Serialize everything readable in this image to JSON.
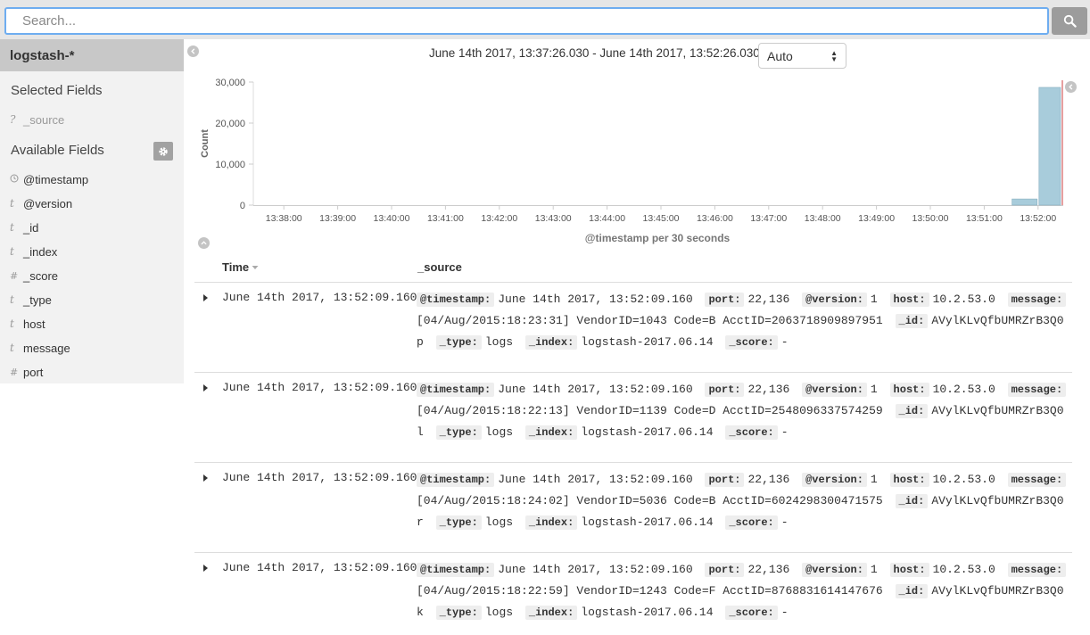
{
  "search": {
    "placeholder": "Search..."
  },
  "sidebar": {
    "index_pattern": "logstash-*",
    "selected_title": "Selected Fields",
    "selected_fields": [
      {
        "type": "?",
        "name": "_source"
      }
    ],
    "available_title": "Available Fields",
    "available_fields": [
      {
        "type": "clock",
        "name": "@timestamp"
      },
      {
        "type": "t",
        "name": "@version"
      },
      {
        "type": "t",
        "name": "_id"
      },
      {
        "type": "t",
        "name": "_index"
      },
      {
        "type": "#",
        "name": "_score"
      },
      {
        "type": "t",
        "name": "_type"
      },
      {
        "type": "t",
        "name": "host"
      },
      {
        "type": "t",
        "name": "message"
      },
      {
        "type": "#",
        "name": "port"
      }
    ]
  },
  "histogram": {
    "range_text": "June 14th 2017, 13:37:26.030 - June 14th 2017, 13:52:26.030 —",
    "interval": "Auto"
  },
  "chart_data": {
    "type": "bar",
    "ylabel": "Count",
    "xlabel": "@timestamp per 30 seconds",
    "ylim": [
      0,
      30000
    ],
    "yticks": [
      "0",
      "10,000",
      "20,000",
      "30,000"
    ],
    "ytick_values": [
      0,
      10000,
      20000,
      30000
    ],
    "xticks": [
      "13:38:00",
      "13:39:00",
      "13:40:00",
      "13:41:00",
      "13:42:00",
      "13:43:00",
      "13:44:00",
      "13:45:00",
      "13:46:00",
      "13:47:00",
      "13:48:00",
      "13:49:00",
      "13:50:00",
      "13:51:00",
      "13:52:00"
    ],
    "bars": [
      {
        "x": "13:51:30",
        "value": 1500
      },
      {
        "x": "13:52:00",
        "value": 28700
      }
    ],
    "bar_color": "#a8ccdb"
  },
  "table": {
    "col_time": "Time",
    "col_source": "_source",
    "rows": [
      {
        "time": "June 14th 2017, 13:52:09.160",
        "fields": [
          {
            "k": "@timestamp:",
            "v": "June 14th 2017, 13:52:09.160"
          },
          {
            "k": "port:",
            "v": "22,136"
          },
          {
            "k": "@version:",
            "v": "1"
          },
          {
            "k": "host:",
            "v": "10.2.53.0"
          },
          {
            "k": "message:",
            "v": "[04/Aug/2015:18:23:31] VendorID=1043 Code=B AcctID=2063718909897951"
          },
          {
            "k": "_id:",
            "v": "AVylKLvQfbUMRZrB3Q0p"
          },
          {
            "k": "_type:",
            "v": "logs"
          },
          {
            "k": "_index:",
            "v": "logstash-2017.06.14"
          },
          {
            "k": "_score:",
            "v": "-"
          }
        ]
      },
      {
        "time": "June 14th 2017, 13:52:09.160",
        "fields": [
          {
            "k": "@timestamp:",
            "v": "June 14th 2017, 13:52:09.160"
          },
          {
            "k": "port:",
            "v": "22,136"
          },
          {
            "k": "@version:",
            "v": "1"
          },
          {
            "k": "host:",
            "v": "10.2.53.0"
          },
          {
            "k": "message:",
            "v": "[04/Aug/2015:18:22:13] VendorID=1139 Code=D AcctID=2548096337574259"
          },
          {
            "k": "_id:",
            "v": "AVylKLvQfbUMRZrB3Q0l"
          },
          {
            "k": "_type:",
            "v": "logs"
          },
          {
            "k": "_index:",
            "v": "logstash-2017.06.14"
          },
          {
            "k": "_score:",
            "v": "-"
          }
        ]
      },
      {
        "time": "June 14th 2017, 13:52:09.160",
        "fields": [
          {
            "k": "@timestamp:",
            "v": "June 14th 2017, 13:52:09.160"
          },
          {
            "k": "port:",
            "v": "22,136"
          },
          {
            "k": "@version:",
            "v": "1"
          },
          {
            "k": "host:",
            "v": "10.2.53.0"
          },
          {
            "k": "message:",
            "v": "[04/Aug/2015:18:24:02] VendorID=5036 Code=B AcctID=6024298300471575"
          },
          {
            "k": "_id:",
            "v": "AVylKLvQfbUMRZrB3Q0r"
          },
          {
            "k": "_type:",
            "v": "logs"
          },
          {
            "k": "_index:",
            "v": "logstash-2017.06.14"
          },
          {
            "k": "_score:",
            "v": "-"
          }
        ]
      },
      {
        "time": "June 14th 2017, 13:52:09.160",
        "fields": [
          {
            "k": "@timestamp:",
            "v": "June 14th 2017, 13:52:09.160"
          },
          {
            "k": "port:",
            "v": "22,136"
          },
          {
            "k": "@version:",
            "v": "1"
          },
          {
            "k": "host:",
            "v": "10.2.53.0"
          },
          {
            "k": "message:",
            "v": "[04/Aug/2015:18:22:59] VendorID=1243 Code=F AcctID=8768831614147676"
          },
          {
            "k": "_id:",
            "v": "AVylKLvQfbUMRZrB3Q0k"
          },
          {
            "k": "_type:",
            "v": "logs"
          },
          {
            "k": "_index:",
            "v": "logstash-2017.06.14"
          },
          {
            "k": "_score:",
            "v": "-"
          }
        ]
      }
    ]
  }
}
